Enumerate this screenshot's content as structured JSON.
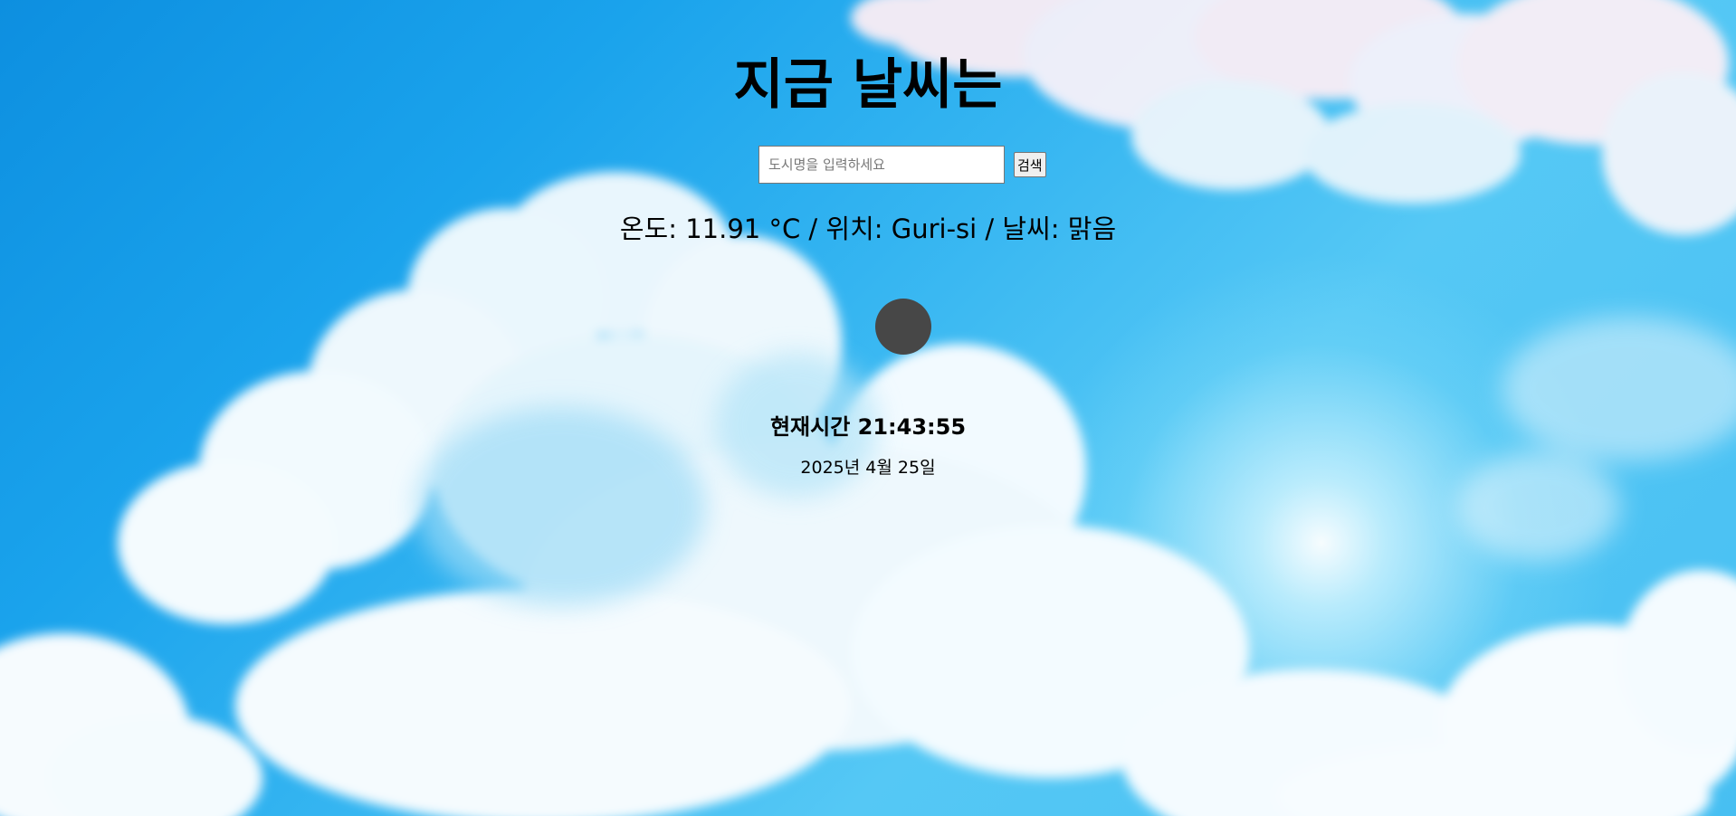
{
  "header": {
    "title": "지금 날씨는"
  },
  "search": {
    "placeholder": "도시명을 입력하세요",
    "value": "",
    "button_label": "검색"
  },
  "weather": {
    "summary": "온도: 11.91 °C / 위치: Guri-si / 날씨: 맑음",
    "temperature": "11.91",
    "unit": "°C",
    "location": "Guri-si",
    "condition": "맑음",
    "icon": "weather-icon-placeholder"
  },
  "clock": {
    "time_text": "현재시간 21:43:55",
    "date_text": "2025년 4월 25일"
  },
  "colors": {
    "sky": "#35b5f1",
    "icon": "#474747"
  }
}
